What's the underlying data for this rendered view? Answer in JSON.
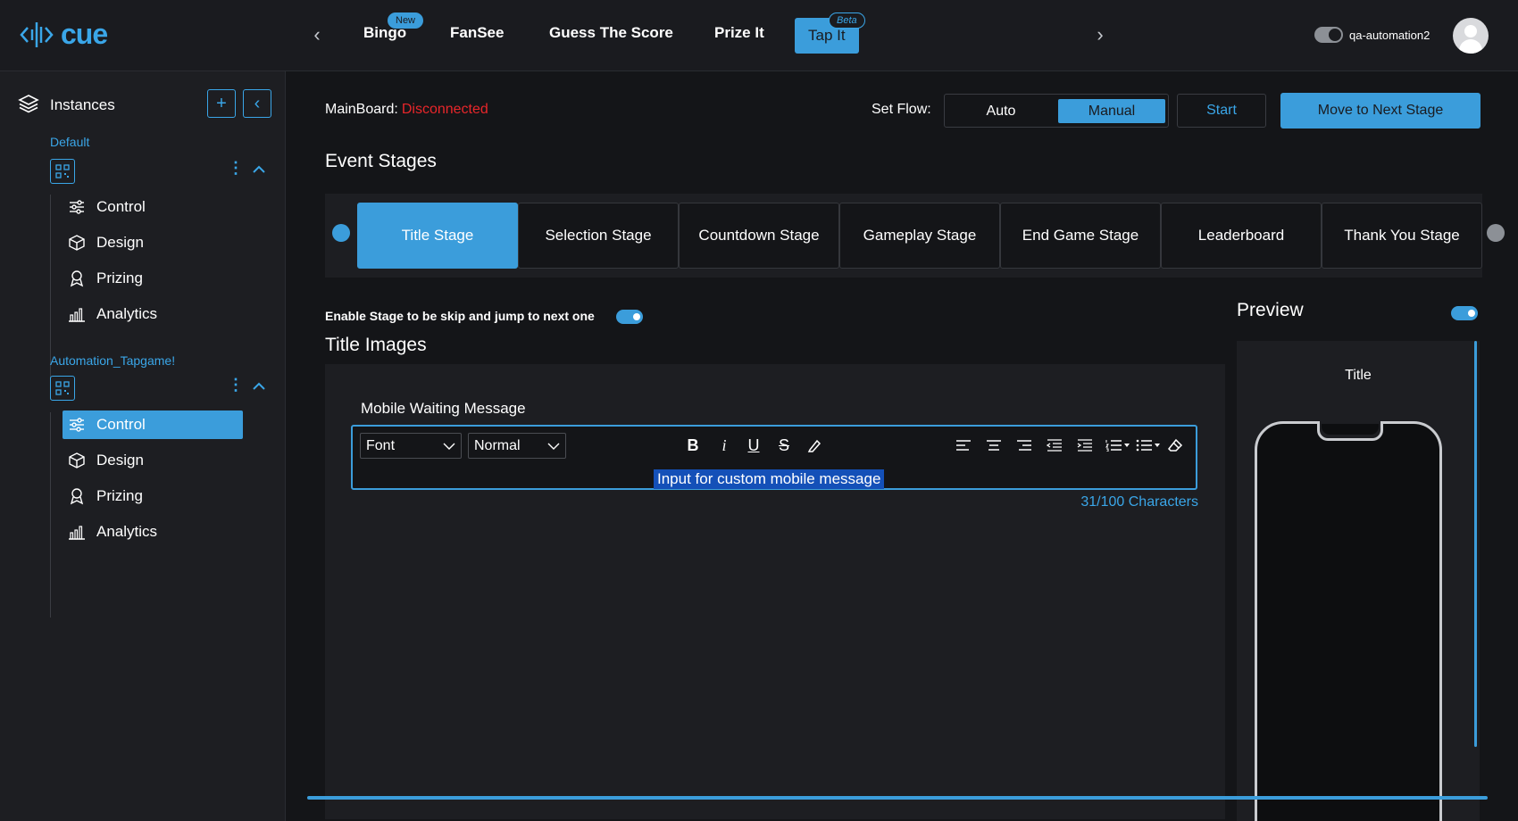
{
  "brand": {
    "name": "cue",
    "accent": "#3aa6e8",
    "status_red": "#e8262a"
  },
  "topnav": {
    "tabs": [
      {
        "label": "Bingo",
        "badge": "New"
      },
      {
        "label": "FanSee"
      },
      {
        "label": "Guess The Score"
      },
      {
        "label": "Prize It"
      },
      {
        "label": "Tap It",
        "badge": "Beta",
        "active": true
      }
    ],
    "user": {
      "name": "qa-automation2"
    }
  },
  "sidebar": {
    "title": "Instances",
    "instances": [
      {
        "name": "Default",
        "items": [
          "Control",
          "Design",
          "Prizing",
          "Analytics"
        ]
      },
      {
        "name": "Automation_Tapgame!",
        "items": [
          "Control",
          "Design",
          "Prizing",
          "Analytics"
        ],
        "active_item": "Control"
      }
    ]
  },
  "header": {
    "mainboard_label": "MainBoard:",
    "mainboard_status": "Disconnected",
    "set_flow_label": "Set Flow:",
    "flow_options": [
      "Auto",
      "Manual"
    ],
    "flow_selected": "Manual",
    "start_label": "Start",
    "next_stage_label": "Move to Next Stage"
  },
  "stages": {
    "heading": "Event Stages",
    "tabs": [
      "Title Stage",
      "Selection Stage",
      "Countdown Stage",
      "Gameplay Stage",
      "End Game Stage",
      "Leaderboard",
      "Thank You Stage"
    ],
    "active": "Title Stage"
  },
  "editor_section": {
    "skip_label": "Enable Stage to be skip and jump to next one",
    "skip_enabled": true,
    "heading": "Title Images",
    "field_label": "Mobile Waiting Message",
    "font_select": "Font",
    "size_select": "Normal",
    "content": "Input for custom mobile message",
    "char_count": "31/100 Characters"
  },
  "preview": {
    "heading": "Preview",
    "enabled": true,
    "screen_title": "Title"
  }
}
